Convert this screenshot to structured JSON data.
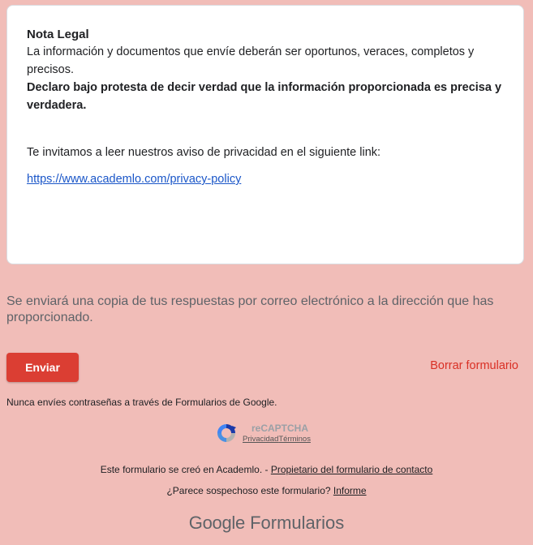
{
  "legal_card": {
    "title": "Nota Legal",
    "text": "La información y documentos que envíe deberán ser oportunos, veraces, completos y precisos.",
    "bold_text": "Declaro bajo protesta de decir verdad que la información proporcionada es precisa y verdadera.",
    "invite_text": "Te invitamos a leer nuestros aviso de privacidad en el siguiente link:",
    "privacy_link": "https://www.academlo.com/privacy-policy"
  },
  "copy_note": "Se enviará una copia de tus respuestas por correo electrónico a la dirección que has proporcionado.",
  "actions": {
    "send_label": "Enviar",
    "clear_label": "Borrar formulario"
  },
  "password_note": "Nunca envíes contraseñas a través de Formularios de Google.",
  "recaptcha": {
    "title": "reCAPTCHA",
    "privacy": "Privacidad",
    "terms": "Términos",
    "logo_icon": "recaptcha-logo-icon"
  },
  "footer": {
    "created_text": "Este formulario se creó en Academlo. - ",
    "contact_owner_link": "Propietario del formulario de contacto",
    "suspicious_text": "¿Parece sospechoso este formulario? ",
    "report_link": "Informe",
    "brand_google": "Google",
    "brand_forms": " Formularios"
  },
  "colors": {
    "page_background": "#f1bdb8",
    "send_button": "#db3e33",
    "clear_link": "#d93025",
    "link": "#1a56c8"
  }
}
